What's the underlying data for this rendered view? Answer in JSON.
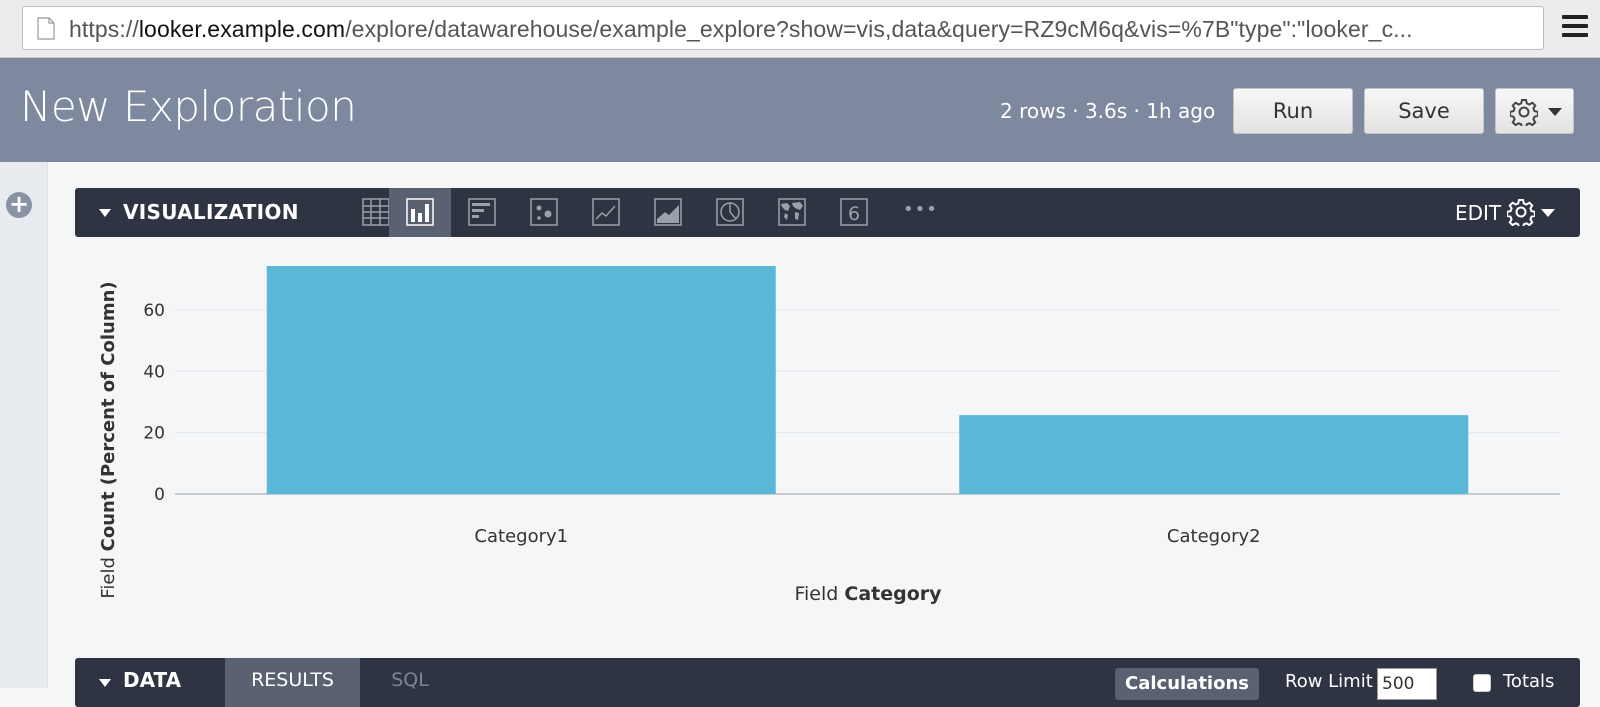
{
  "browser": {
    "url_host_prefix": "https://",
    "url_host": "looker.example.com",
    "url_path": "/explore/datawarehouse/example_explore?show=vis,data&query=RZ9cM6q&vis=%7B\"type\":\"looker_c..."
  },
  "header": {
    "title": "New Exploration",
    "status": "2 rows · 3.6s · 1h ago",
    "run_label": "Run",
    "save_label": "Save"
  },
  "visualization": {
    "label": "VISUALIZATION",
    "edit_label": "EDIT",
    "number_icon_label": "6",
    "more_label": "•••",
    "types": [
      "table",
      "column",
      "bar",
      "scatter",
      "line",
      "area",
      "pie",
      "map",
      "single-value",
      "more"
    ],
    "active_type": "column"
  },
  "chart_data": {
    "type": "bar",
    "categories": [
      "Category1",
      "Category2"
    ],
    "values": [
      74.3,
      25.7
    ],
    "xlabel_prefix": "Field",
    "xlabel_bold": "Category",
    "ylabel_prefix": "Field",
    "ylabel_bold": "Count (Percent of Column)",
    "yticks": [
      0,
      20,
      40,
      60
    ],
    "ylim": [
      0,
      74.3
    ],
    "bar_color": "#5bb7d6",
    "grid": true
  },
  "data_panel": {
    "label": "DATA",
    "tab_results": "RESULTS",
    "tab_sql": "SQL",
    "calculations_label": "Calculations",
    "row_limit_label": "Row Limit",
    "row_limit_value": "500",
    "totals_label": "Totals"
  },
  "colors": {
    "header_bg": "#7e889e",
    "bar_dark": "#2e3442",
    "bar": "#5bb7d6"
  }
}
